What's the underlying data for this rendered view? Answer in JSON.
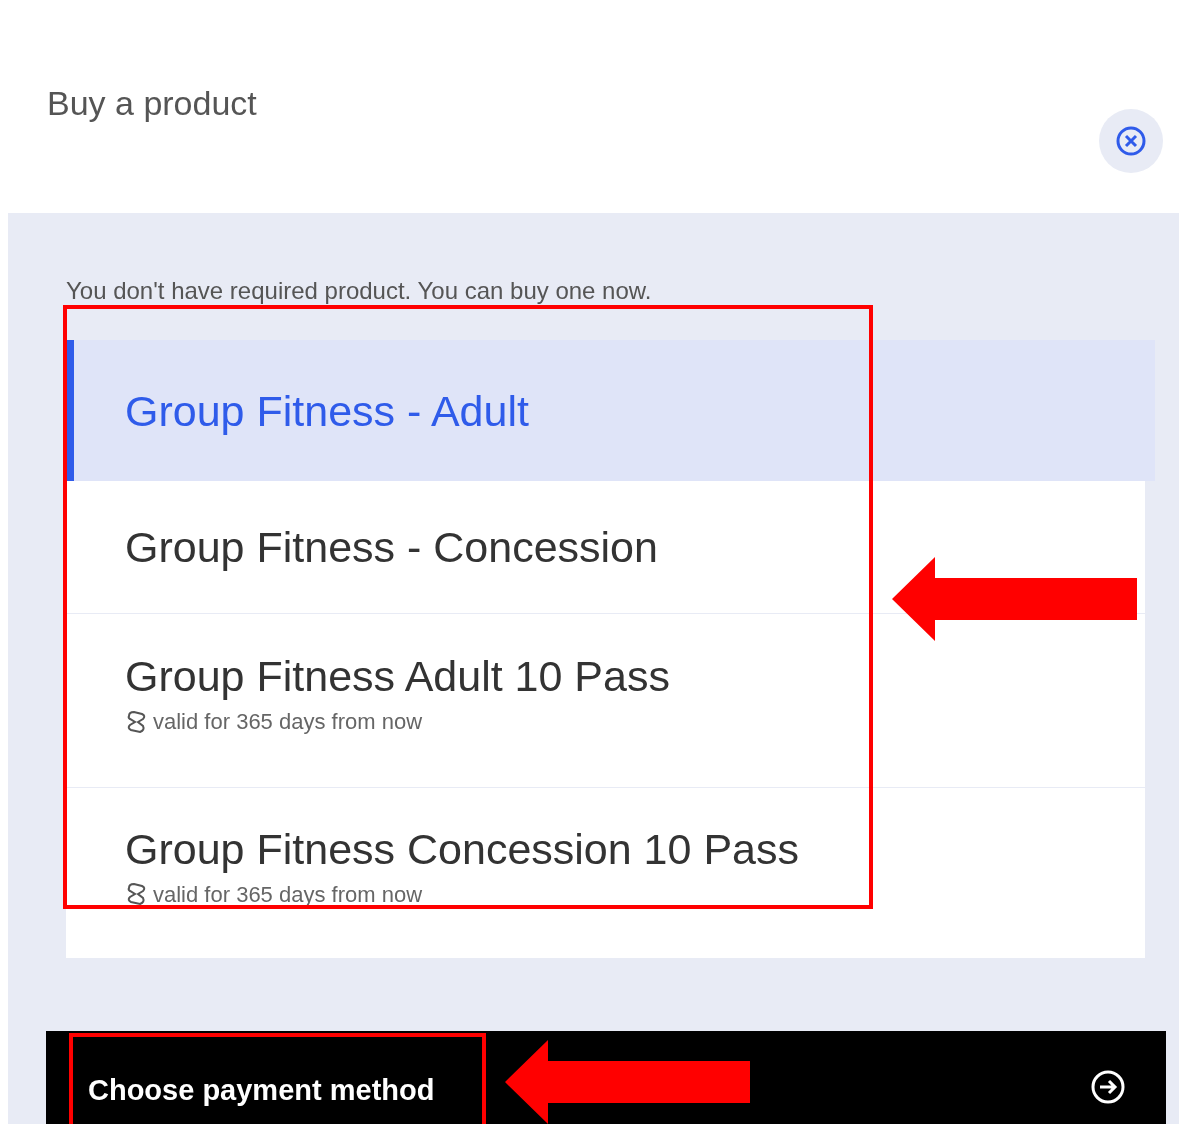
{
  "dialog": {
    "title": "Buy a product"
  },
  "message": "You don't have required product. You can buy one now.",
  "products": [
    {
      "name": "Group Fitness - Adult",
      "selected": true
    },
    {
      "name": "Group Fitness - Concession",
      "selected": false
    },
    {
      "name": "Group Fitness Adult 10 Pass",
      "selected": false,
      "validity": "valid for 365 days from now"
    },
    {
      "name": "Group Fitness Concession 10 Pass",
      "selected": false,
      "validity": "valid for 365 days from now"
    }
  ],
  "action_button": {
    "label": "Choose payment method"
  }
}
